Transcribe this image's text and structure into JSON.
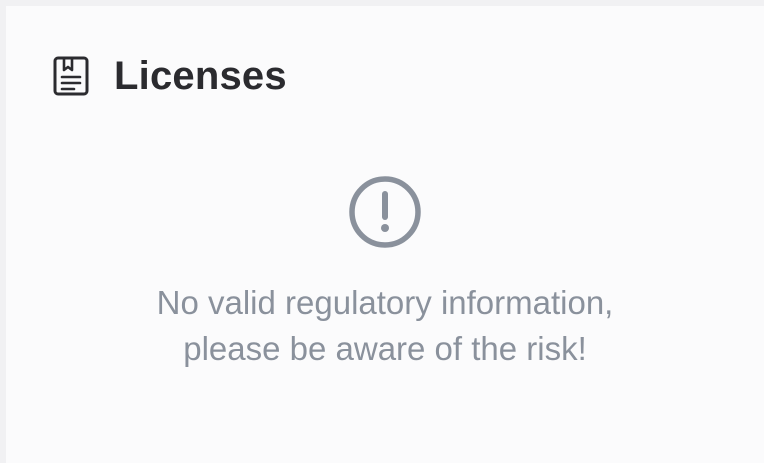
{
  "header": {
    "title": "Licenses",
    "icon": "license-document-icon"
  },
  "empty_state": {
    "icon": "alert-circle-icon",
    "message_line1": "No valid regulatory information,",
    "message_line2": "please be aware of the risk!"
  },
  "colors": {
    "title": "#2b2b2f",
    "muted": "#8a919c",
    "panel_bg": "#fbfbfc",
    "page_bg": "#f1f1f3"
  }
}
